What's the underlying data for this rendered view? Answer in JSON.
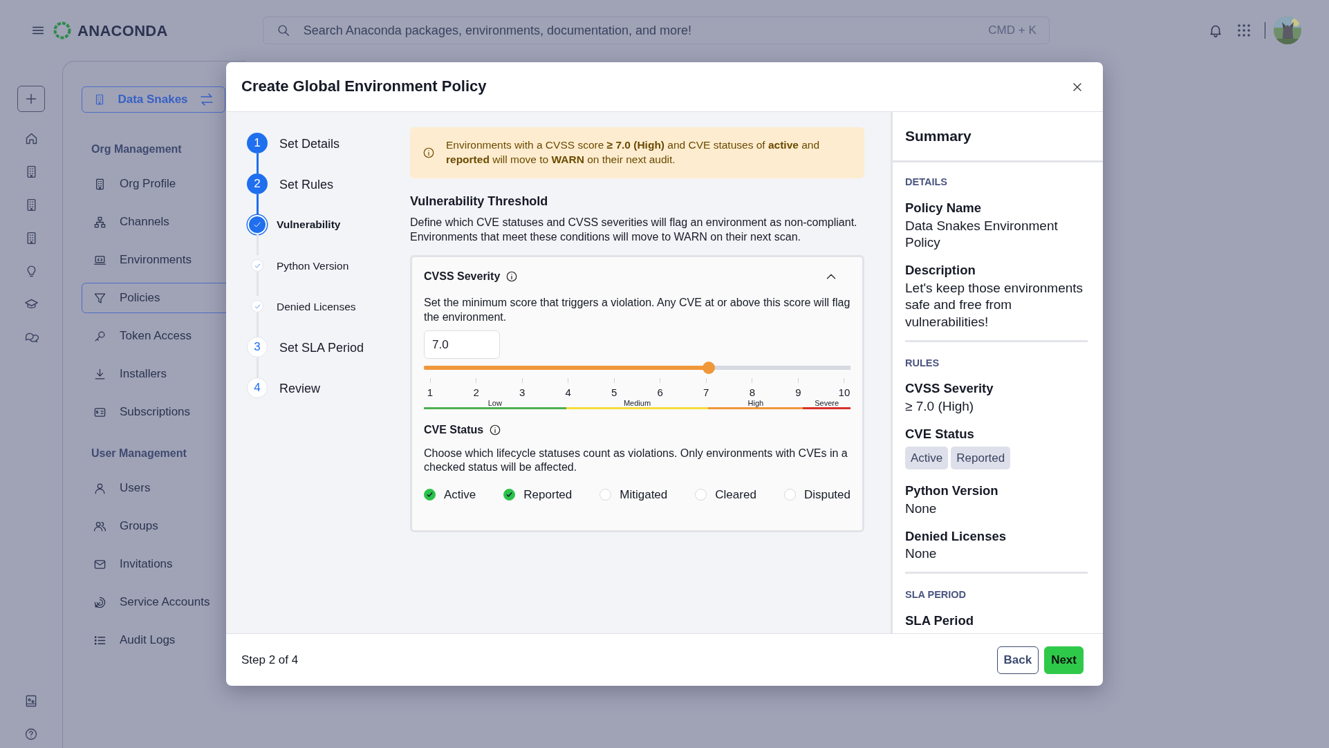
{
  "topbar": {
    "logo": "ANACONDA",
    "search": {
      "placeholder": "Search Anaconda packages, environments, documentation, and more!",
      "shortcut": "CMD + K"
    }
  },
  "sidebar": {
    "org": "Data Snakes",
    "sections": [
      {
        "title": "Org Management",
        "items": [
          {
            "label": "Org Profile",
            "selected": false
          },
          {
            "label": "Channels",
            "selected": false
          },
          {
            "label": "Environments",
            "selected": false
          },
          {
            "label": "Policies",
            "selected": true
          },
          {
            "label": "Token Access",
            "selected": false
          },
          {
            "label": "Installers",
            "selected": false
          },
          {
            "label": "Subscriptions",
            "selected": false
          }
        ]
      },
      {
        "title": "User Management",
        "items": [
          {
            "label": "Users",
            "selected": false
          },
          {
            "label": "Groups",
            "selected": false
          },
          {
            "label": "Invitations",
            "selected": false
          },
          {
            "label": "Service Accounts",
            "selected": false
          },
          {
            "label": "Audit Logs",
            "selected": false
          }
        ]
      }
    ]
  },
  "dialog": {
    "title": "Create Global Environment Policy",
    "steps": [
      {
        "number": "1",
        "label": "Set Details",
        "active": true
      },
      {
        "number": "2",
        "label": "Set Rules",
        "active": true,
        "children": [
          {
            "label": "Vulnerability",
            "selected": true
          },
          {
            "label": "Python Version",
            "selected": false
          },
          {
            "label": "Denied Licenses",
            "selected": false
          }
        ]
      },
      {
        "number": "3",
        "label": "Set SLA Period",
        "active": false
      },
      {
        "number": "4",
        "label": "Review",
        "active": false
      }
    ],
    "alert": "Environments with a CVSS score **≥ 7.0 (High)** and CVE statuses of **active** and **reported** will move to **WARN** on their next audit.",
    "section": {
      "title": "Vulnerability Threshold",
      "description": "Define which CVE statuses and CVSS severities will flag an environment as non-compliant. Environments that meet these conditions will move to WARN on their next scan."
    },
    "severity": {
      "title": "CVSS Severity",
      "expanded": true,
      "description": "Set the minimum score that triggers a violation. Any CVE at or above this score will flag the environment.",
      "value": "7.0",
      "level": 0.667,
      "ticks": [
        "1",
        "2",
        "3",
        "4",
        "5",
        "6",
        "7",
        "8",
        "9",
        "10"
      ],
      "bands": [
        {
          "label": "Low",
          "color": "#4caf50"
        },
        {
          "label": "Medium",
          "color": "#f5dc3c"
        },
        {
          "label": "High",
          "color": "#f0973a"
        },
        {
          "label": "Severe",
          "color": "#d9302c"
        }
      ]
    },
    "status": {
      "title": "CVE Status",
      "description": "Choose which lifecycle statuses count as violations. Only environments with CVEs in a checked status will be affected.",
      "options": [
        {
          "label": "Active",
          "checked": true
        },
        {
          "label": "Reported",
          "checked": true
        },
        {
          "label": "Mitigated",
          "checked": false
        },
        {
          "label": "Cleared",
          "checked": false
        },
        {
          "label": "Disputed",
          "checked": false
        }
      ]
    },
    "summary": {
      "title": "Summary",
      "sections": [
        {
          "heading": "DETAILS",
          "fields": [
            {
              "label": "Policy Name",
              "value": "Data Snakes Environment Policy"
            },
            {
              "label": "Description",
              "value": "Let's keep those environments safe and free from vulnerabilities!"
            }
          ]
        },
        {
          "heading": "RULES",
          "fields": [
            {
              "label": "CVSS Severity",
              "value": "≥ 7.0 (High)"
            },
            {
              "label": "CVE Status",
              "tags": [
                "Active",
                "Reported"
              ]
            },
            {
              "label": "Python Version",
              "value": "None"
            },
            {
              "label": "Denied Licenses",
              "value": "None"
            }
          ]
        },
        {
          "heading": "SLA PERIOD",
          "fields": [
            {
              "label": "SLA Period"
            }
          ]
        }
      ]
    },
    "footer": {
      "step": "Step 2 of 4",
      "buttons": [
        {
          "label": "Back",
          "kind": "secondary"
        },
        {
          "label": "Next",
          "kind": "primary"
        }
      ]
    }
  }
}
